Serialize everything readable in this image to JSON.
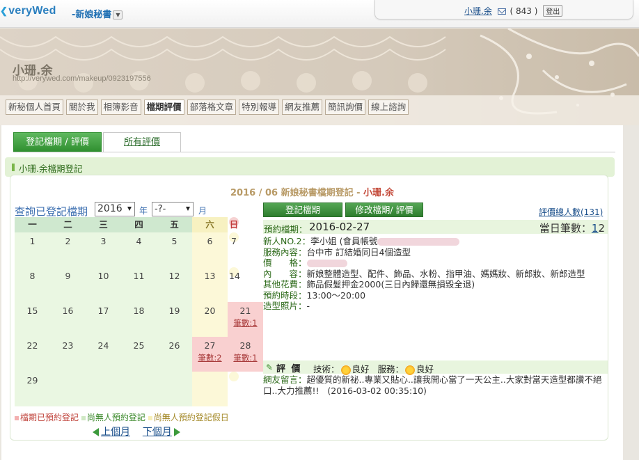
{
  "header": {
    "logo": "veryWed",
    "service": "-新娘秘書",
    "user_name": "小珊.余",
    "mail_count": "( 843 )",
    "logout_label": "登出"
  },
  "profile": {
    "name": "小珊.余",
    "url": "http://verywed.com/makeup/0923197556"
  },
  "nav": [
    "新秘個人首頁",
    "關於我",
    "相簿影音",
    "檔期評價",
    "部落格文章",
    "特別報導",
    "網友推薦",
    "簡訊詢價",
    "線上諮詢"
  ],
  "tabs": {
    "register": "登記檔期 / 評價",
    "all": "所有評價"
  },
  "section_title": "小珊.余檔期登記",
  "calendar_title": {
    "prefix": "2016 / 06 新娘秘書檔期登記 - ",
    "name": "小珊.余"
  },
  "query": {
    "label": "查詢已登記檔期",
    "year": "2016",
    "year_unit": "年",
    "month": "-?-",
    "month_unit": "月"
  },
  "buttons": {
    "register": "登記檔期",
    "edit": "修改檔期/ 評價"
  },
  "eval_count": "評價總人數(131)",
  "weekdays": [
    "一",
    "二",
    "三",
    "四",
    "五",
    "六",
    "日"
  ],
  "weeks": [
    [
      {
        "d": "1"
      },
      {
        "d": "2"
      },
      {
        "d": "3"
      },
      {
        "d": "4"
      },
      {
        "d": "5"
      },
      {
        "d": "6"
      },
      {
        "d": "7"
      }
    ],
    [
      {
        "d": "8"
      },
      {
        "d": "9"
      },
      {
        "d": "10"
      },
      {
        "d": "11"
      },
      {
        "d": "12"
      },
      {
        "d": "13"
      },
      {
        "d": "14"
      }
    ],
    [
      {
        "d": "15"
      },
      {
        "d": "16"
      },
      {
        "d": "17"
      },
      {
        "d": "18"
      },
      {
        "d": "19"
      },
      {
        "d": "20"
      },
      {
        "d": "21",
        "count": "筆數:1"
      }
    ],
    [
      {
        "d": "22"
      },
      {
        "d": "23"
      },
      {
        "d": "24"
      },
      {
        "d": "25"
      },
      {
        "d": "26"
      },
      {
        "d": "27",
        "count": "筆數:2"
      },
      {
        "d": "28",
        "count": "筆數:1"
      }
    ],
    [
      {
        "d": "29"
      },
      {
        "d": ""
      },
      {
        "d": ""
      },
      {
        "d": ""
      },
      {
        "d": ""
      },
      {
        "d": ""
      },
      {
        "d": ""
      }
    ]
  ],
  "legend": {
    "booked": "檔期已預約登記",
    "free": "尚無人預約登記",
    "free_holiday": "尚無人預約登記假日"
  },
  "month_nav": {
    "prev": "上個月",
    "next": "下個月"
  },
  "detail": {
    "date_label": "預約檔期：",
    "date_value": "2016-02-27",
    "daily_label": "當日筆數：",
    "daily_pages": [
      "1",
      "2"
    ],
    "bride_label": "新人NO.2：",
    "bride_value": "李小姐 (",
    "member_label": "會員帳號",
    "service_label": "服務內容：",
    "service_value": "台中市 訂結婚同日4個造型",
    "price_label": "價　　格：",
    "content_label": "內　　容：",
    "content_value": "新娘整體造型、配件、飾品、水粉、指甲油、媽媽妝、新郎妝、新郎造型",
    "other_label": "其他花費：",
    "other_value": "飾品假髮押金2000(三日內歸還無損毀全退)",
    "time_label": "預約時段：",
    "time_value": "13:00～20:00",
    "photo_label": "造型照片：",
    "photo_value": "-"
  },
  "evaluation": {
    "title": "評 價",
    "skill_label": "技術：",
    "skill_value": "良好",
    "service_label": "服務：",
    "service_value": "良好"
  },
  "comment": {
    "label": "網友留言：",
    "text": "超優質的新祕..專業又貼心..讓我開心當了一天公主..大家對當天造型都讚不絕口..大力推薦!!",
    "time": "(2016-03-02 00:35:10)"
  }
}
